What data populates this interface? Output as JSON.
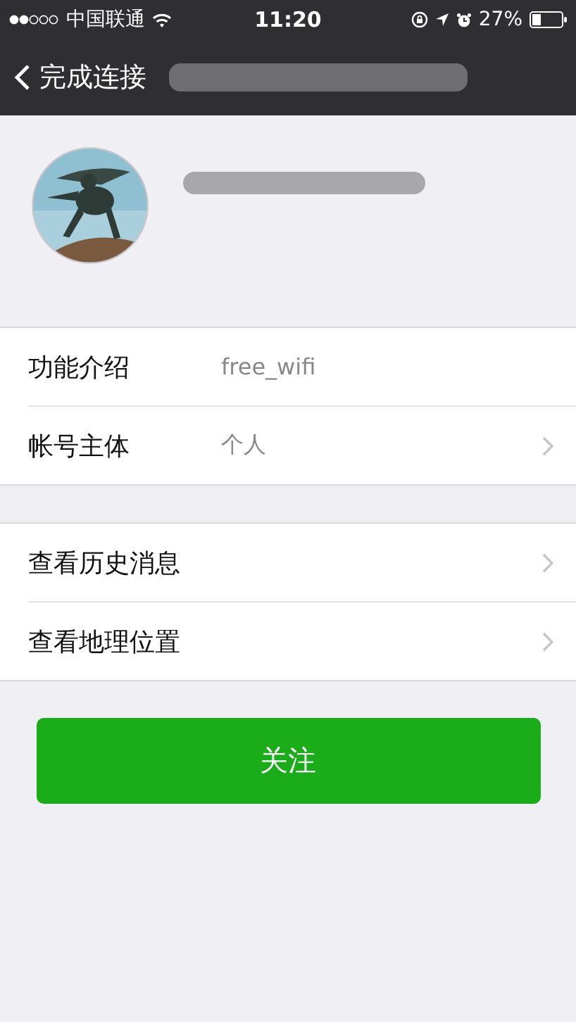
{
  "status_bar": {
    "carrier": "中国联通",
    "time": "11:20",
    "battery": "27%"
  },
  "nav_bar": {
    "back_label": "完成连接"
  },
  "sections": [
    [
      {
        "label": "功能介绍",
        "value": "free_wifi",
        "chevron": false
      },
      {
        "label": "帐号主体",
        "value": "个人",
        "chevron": true
      }
    ],
    [
      {
        "label": "查看历史消息",
        "chevron": true
      },
      {
        "label": "查看地理位置",
        "chevron": true
      }
    ]
  ],
  "follow_button": "关注"
}
